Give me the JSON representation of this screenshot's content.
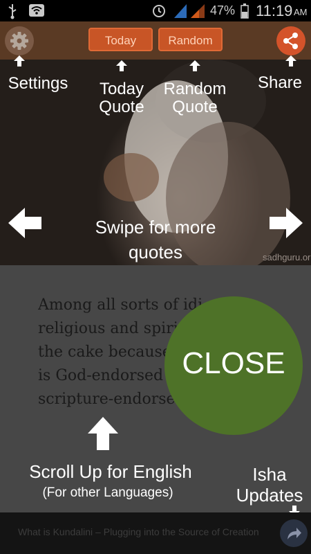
{
  "status_bar": {
    "battery": "47%",
    "time": "11:19",
    "ampm": "AM"
  },
  "app_bar": {
    "today_label": "Today",
    "random_label": "Random"
  },
  "hero": {
    "watermark": "sadhguru.org"
  },
  "tutorial": {
    "settings": "Settings",
    "today_quote": [
      "Today",
      "Quote"
    ],
    "random_quote": [
      "Random",
      "Quote"
    ],
    "share": "Share",
    "swipe": [
      "Swipe for more",
      "quotes"
    ],
    "scroll_up": "Scroll Up for English",
    "other_languages": "(For other Languages)",
    "isha_updates": [
      "Isha",
      "Updates"
    ],
    "close": "CLOSE"
  },
  "quote": {
    "lines": [
      "Among all sorts of idi",
      "religious and spiri",
      "the cake because",
      "is God-endorsed",
      "scripture-endorse"
    ]
  },
  "ticker": {
    "text": "What is Kundalini – Plugging into the Source of Creation"
  },
  "colors": {
    "accent": "#c85526",
    "close": "#4e7228",
    "appbar": "#5a3a24"
  },
  "icons": [
    "usb-icon",
    "wifi-icon",
    "alarm-icon",
    "signal-icon",
    "battery-icon",
    "gear-icon",
    "share-icon",
    "forward-icon",
    "arrow-up-icon",
    "arrow-left-icon",
    "arrow-right-icon",
    "arrow-down-icon"
  ]
}
